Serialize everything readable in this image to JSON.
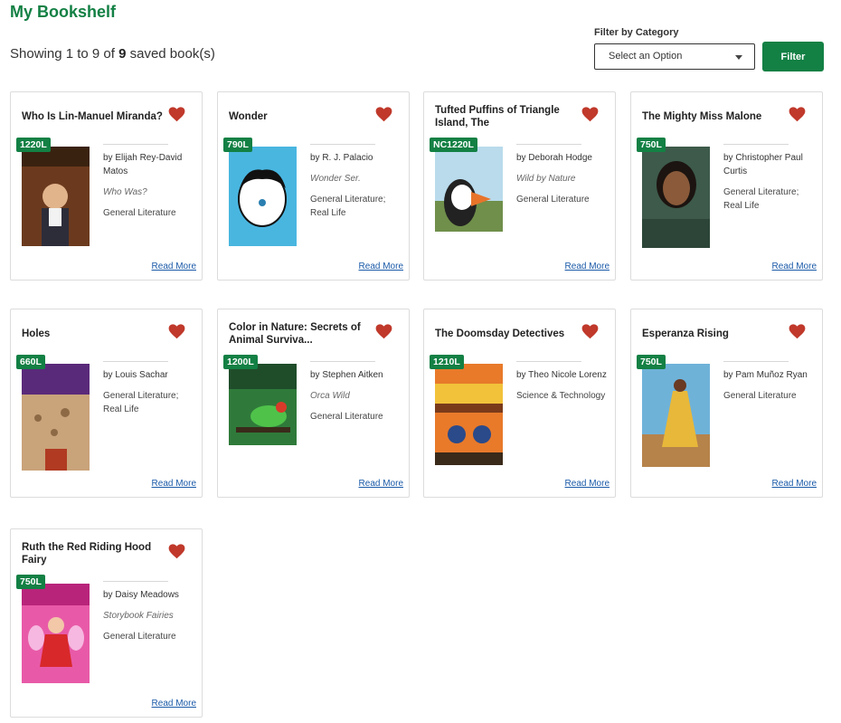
{
  "page": {
    "title": "My Bookshelf"
  },
  "results": {
    "prefix": "Showing 1 to 9 of",
    "total": "9",
    "suffix": "saved book(s)"
  },
  "filter": {
    "label": "Filter by Category",
    "selected": "Select an Option",
    "button_label": "Filter"
  },
  "read_more_label": "Read More",
  "colors": {
    "brand_green": "#138044",
    "heart_red": "#c0392b",
    "link_blue": "#1a5aa8"
  },
  "books": [
    {
      "title": "Who Is Lin-Manuel Miranda?",
      "lexile": "1220L",
      "author": "by Elijah Rey-David Matos",
      "series": "Who Was?",
      "genre": "General Literature"
    },
    {
      "title": "Wonder",
      "lexile": "790L",
      "author": "by R. J. Palacio",
      "series": "Wonder Ser.",
      "genre": "General Literature; Real Life"
    },
    {
      "title": "Tufted Puffins of Triangle Island, The",
      "lexile": "NC1220L",
      "author": "by Deborah Hodge",
      "series": "Wild by Nature",
      "genre": "General Literature"
    },
    {
      "title": "The Mighty Miss Malone",
      "lexile": "750L",
      "author": "by Christopher Paul Curtis",
      "series": "",
      "genre": "General Literature; Real Life"
    },
    {
      "title": "Holes",
      "lexile": "660L",
      "author": "by Louis Sachar",
      "series": "",
      "genre": "General Literature; Real Life"
    },
    {
      "title": "Color in Nature: Secrets of Animal Surviva...",
      "lexile": "1200L",
      "author": "by Stephen Aitken",
      "series": "Orca Wild",
      "genre": "General Literature"
    },
    {
      "title": "The Doomsday Detectives",
      "lexile": "1210L",
      "author": "by Theo Nicole Lorenz",
      "series": "",
      "genre": "Science & Technology"
    },
    {
      "title": "Esperanza Rising",
      "lexile": "750L",
      "author": "by Pam Muñoz Ryan",
      "series": "",
      "genre": "General Literature"
    },
    {
      "title": "Ruth the Red Riding Hood Fairy",
      "lexile": "750L",
      "author": "by Daisy Meadows",
      "series": "Storybook Fairies",
      "genre": "General Literature"
    }
  ]
}
